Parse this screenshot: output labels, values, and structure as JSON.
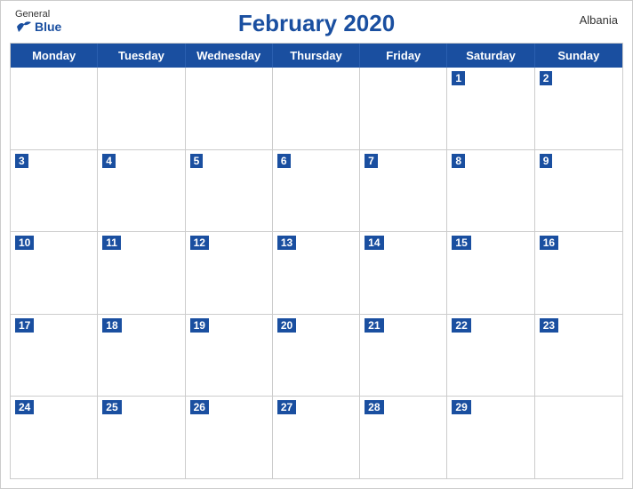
{
  "logo": {
    "general": "General",
    "blue": "Blue"
  },
  "title": "February 2020",
  "country": "Albania",
  "dayHeaders": [
    "Monday",
    "Tuesday",
    "Wednesday",
    "Thursday",
    "Friday",
    "Saturday",
    "Sunday"
  ],
  "weeks": [
    [
      {
        "num": "",
        "empty": true
      },
      {
        "num": "",
        "empty": true
      },
      {
        "num": "",
        "empty": true
      },
      {
        "num": "",
        "empty": true
      },
      {
        "num": "",
        "empty": true
      },
      {
        "num": "1"
      },
      {
        "num": "2"
      }
    ],
    [
      {
        "num": "3"
      },
      {
        "num": "4"
      },
      {
        "num": "5"
      },
      {
        "num": "6"
      },
      {
        "num": "7"
      },
      {
        "num": "8"
      },
      {
        "num": "9"
      }
    ],
    [
      {
        "num": "10"
      },
      {
        "num": "11"
      },
      {
        "num": "12"
      },
      {
        "num": "13"
      },
      {
        "num": "14"
      },
      {
        "num": "15"
      },
      {
        "num": "16"
      }
    ],
    [
      {
        "num": "17"
      },
      {
        "num": "18"
      },
      {
        "num": "19"
      },
      {
        "num": "20"
      },
      {
        "num": "21"
      },
      {
        "num": "22"
      },
      {
        "num": "23"
      }
    ],
    [
      {
        "num": "24"
      },
      {
        "num": "25"
      },
      {
        "num": "26"
      },
      {
        "num": "27"
      },
      {
        "num": "28"
      },
      {
        "num": "29"
      },
      {
        "num": "",
        "empty": true
      }
    ]
  ],
  "colors": {
    "blue": "#1a4fa0",
    "white": "#ffffff"
  }
}
